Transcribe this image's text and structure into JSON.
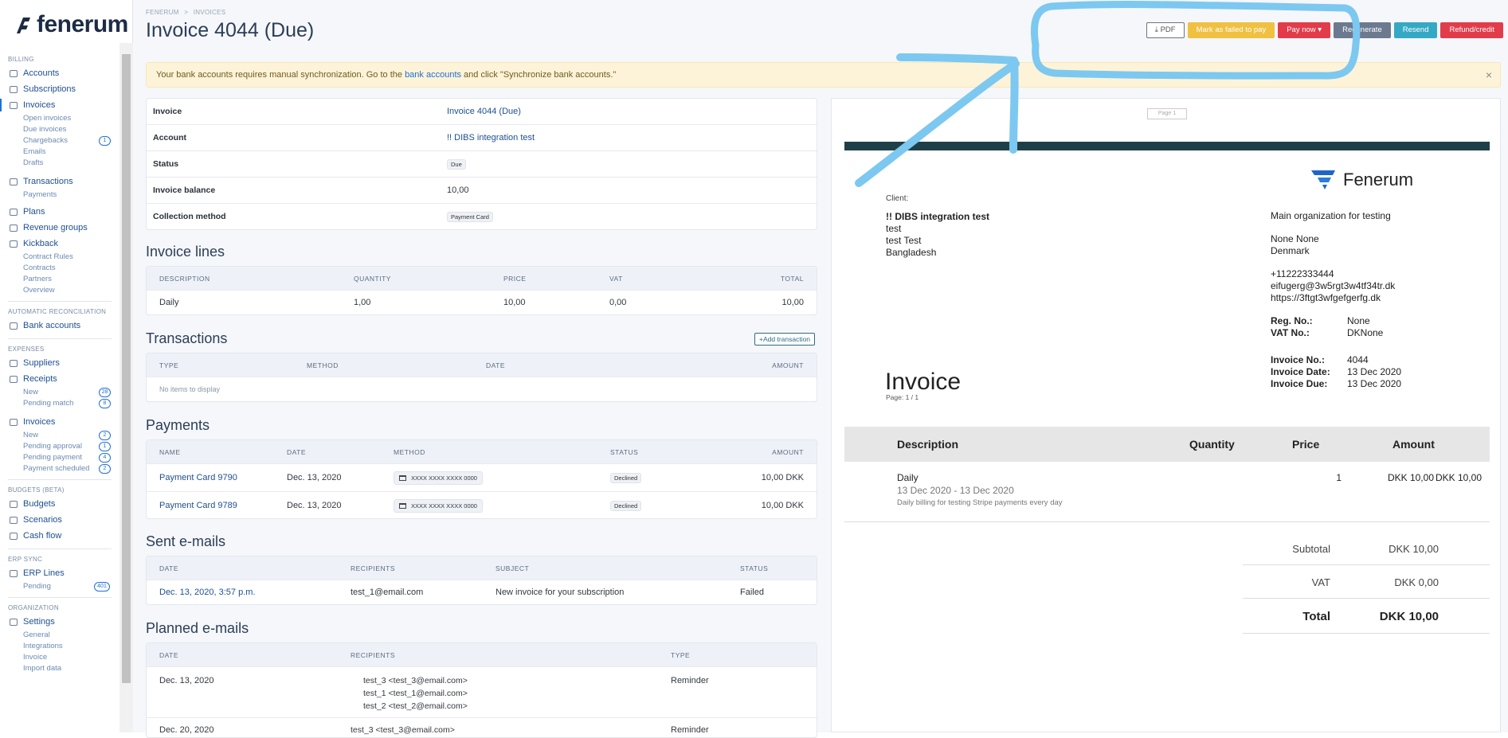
{
  "brand": {
    "name": "fenerum"
  },
  "sidebar": {
    "billing_label": "BILLING",
    "billing": [
      {
        "label": "Accounts",
        "sub": []
      },
      {
        "label": "Subscriptions",
        "sub": []
      },
      {
        "label": "Invoices",
        "sub": [
          {
            "label": "Open invoices"
          },
          {
            "label": "Due invoices"
          },
          {
            "label": "Chargebacks",
            "badge": "1"
          },
          {
            "label": "Emails"
          },
          {
            "label": "Drafts"
          }
        ]
      },
      {
        "label": "Transactions",
        "sub": [
          {
            "label": "Payments"
          }
        ]
      },
      {
        "label": "Plans",
        "sub": []
      },
      {
        "label": "Revenue groups",
        "sub": []
      },
      {
        "label": "Kickback",
        "sub": [
          {
            "label": "Contract Rules"
          },
          {
            "label": "Contracts"
          },
          {
            "label": "Partners"
          },
          {
            "label": "Overview"
          }
        ]
      }
    ],
    "recon_label": "AUTOMATIC RECONCILIATION",
    "bank_accounts": "Bank accounts",
    "expenses_label": "EXPENSES",
    "suppliers": "Suppliers",
    "receipts": "Receipts",
    "receipts_sub": [
      {
        "label": "New",
        "badge": "28"
      },
      {
        "label": "Pending match",
        "badge": "8"
      }
    ],
    "exp_invoices": "Invoices",
    "exp_invoices_sub": [
      {
        "label": "New",
        "badge": "2"
      },
      {
        "label": "Pending approval",
        "badge": "1"
      },
      {
        "label": "Pending payment",
        "badge": "4"
      },
      {
        "label": "Payment scheduled",
        "badge": "2"
      }
    ],
    "budgets_label": "BUDGETS (BETA)",
    "budgets": "Budgets",
    "scenarios": "Scenarios",
    "cashflow": "Cash flow",
    "erp_label": "ERP SYNC",
    "erp_lines": "ERP Lines",
    "pending": "Pending",
    "pending_badge": "401",
    "org_label": "ORGANIZATION",
    "settings": "Settings",
    "settings_sub": [
      {
        "label": "General"
      },
      {
        "label": "Integrations"
      },
      {
        "label": "Invoice"
      },
      {
        "label": "Import data"
      }
    ]
  },
  "breadcrumb": {
    "a": "FENERUM",
    "sep": ">",
    "b": "INVOICES"
  },
  "page_title": "Invoice 4044 (Due)",
  "actions": {
    "pdf": "PDF",
    "failed": "Mark as failed to pay",
    "pay": "Pay now",
    "regen": "Regenerate",
    "resend": "Resend",
    "refund": "Refund/credit"
  },
  "alert": {
    "pre": "Your bank accounts requires manual synchronization. Go to the ",
    "link": "bank accounts",
    "post": " and click \"Synchronize bank accounts.\"",
    "close": "×"
  },
  "info": [
    {
      "k": "Invoice",
      "v": "Invoice 4044 (Due)"
    },
    {
      "k": "Account",
      "v": "!! DIBS integration test"
    },
    {
      "k": "Status",
      "v": "Due"
    },
    {
      "k": "Invoice balance",
      "v": "10,00"
    },
    {
      "k": "Collection method",
      "v": "Payment Card"
    }
  ],
  "lines": {
    "title": "Invoice lines",
    "headers": [
      "DESCRIPTION",
      "QUANTITY",
      "PRICE",
      "VAT",
      "TOTAL"
    ],
    "rows": [
      [
        "Daily",
        "1,00",
        "10,00",
        "0,00",
        "10,00"
      ]
    ]
  },
  "transactions": {
    "title": "Transactions",
    "add": "Add transaction",
    "headers": [
      "TYPE",
      "METHOD",
      "DATE",
      "AMOUNT"
    ],
    "empty": "No items to display"
  },
  "payments": {
    "title": "Payments",
    "headers": [
      "NAME",
      "DATE",
      "METHOD",
      "STATUS",
      "AMOUNT"
    ],
    "rows": [
      {
        "name": "Payment Card 9790",
        "date": "Dec. 13, 2020",
        "method": "XXXX XXXX XXXX 0000",
        "status": "Declined",
        "amount": "10,00 DKK"
      },
      {
        "name": "Payment Card 9789",
        "date": "Dec. 13, 2020",
        "method": "XXXX XXXX XXXX 0000",
        "status": "Declined",
        "amount": "10,00 DKK"
      }
    ]
  },
  "sent": {
    "title": "Sent e-mails",
    "headers": [
      "DATE",
      "RECIPIENTS",
      "SUBJECT",
      "STATUS"
    ],
    "rows": [
      {
        "date": "Dec. 13, 2020, 3:57 p.m.",
        "recipients": "test_1@email.com",
        "subject": "New invoice for your subscription",
        "status": "Failed"
      }
    ]
  },
  "planned": {
    "title": "Planned e-mails",
    "headers": [
      "DATE",
      "RECIPIENTS",
      "TYPE"
    ],
    "rows": [
      {
        "date": "Dec. 13, 2020",
        "r1": "test_3 <test_3@email.com>",
        "r2": "test_1 <test_1@email.com>",
        "r3": "test_2 <test_2@email.com>",
        "type": "Reminder"
      },
      {
        "date": "Dec. 20, 2020",
        "r1": "test_3 <test_3@email.com>",
        "type": "Reminder"
      }
    ]
  },
  "preview": {
    "page_box": "Page 1",
    "company": "Fenerum",
    "client_label": "Client:",
    "client_name": "!! DIBS integration test",
    "client_l1": "test",
    "client_l2": "test Test",
    "client_l3": "Bangladesh",
    "org": "Main organization for testing",
    "org_l1": "None None",
    "org_l2": "Denmark",
    "phone": "+11222333444",
    "email": "eifugerg@3w5rgt3w4tf34tr.dk",
    "web": "https://3ftgt3wfgefgerfg.dk",
    "reg_k": "Reg. No.:",
    "reg_v": "None",
    "vat_k": "VAT No.:",
    "vat_v": "DKNone",
    "inv_title": "Invoice",
    "page": "Page: 1 / 1",
    "invno_k": "Invoice No.:",
    "invno_v": "4044",
    "invdate_k": "Invoice Date:",
    "invdate_v": "13 Dec 2020",
    "invdue_k": "Invoice Due:",
    "invdue_v": "13 Dec 2020",
    "th_desc": "Description",
    "th_qty": "Quantity",
    "th_price": "Price",
    "th_amount": "Amount",
    "line_desc": "Daily",
    "line_period": "13 Dec 2020 - 13 Dec 2020",
    "line_note": "Daily billing for testing Stripe payments every day",
    "line_qty": "1",
    "line_price": "DKK 10,00",
    "line_amount": "DKK 10,00",
    "subtotal_k": "Subtotal",
    "subtotal_v": "DKK 10,00",
    "vat_row_k": "VAT",
    "vat_row_v": "DKK 0,00",
    "total_k": "Total",
    "total_v": "DKK 10,00"
  },
  "colors": {
    "accent": "#1e4f92",
    "annotation": "#7cc8f0",
    "pay_btn": "#e23c4a"
  }
}
